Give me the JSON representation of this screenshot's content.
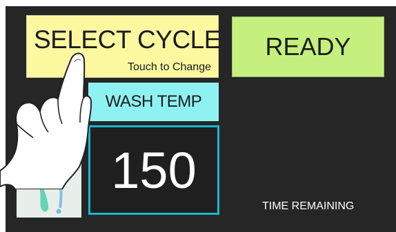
{
  "controls": {
    "select_cycle": {
      "title": "SELECT CYCLE",
      "hint": "Touch to Change"
    },
    "status": "READY",
    "wash_temp_label": "WASH TEMP",
    "wash_temp_value": "150",
    "time_remaining_label": "TIME REMAINING"
  },
  "colors": {
    "background": "#262626",
    "select_cycle": "#fbf8a0",
    "ready": "#c6f07d",
    "wash_temp": "#8ff2f2",
    "temp_border": "#17b8d6"
  },
  "icons": {
    "hand": "pointing-hand-icon",
    "thumbnail": "cycle-thumbnail-icon"
  }
}
